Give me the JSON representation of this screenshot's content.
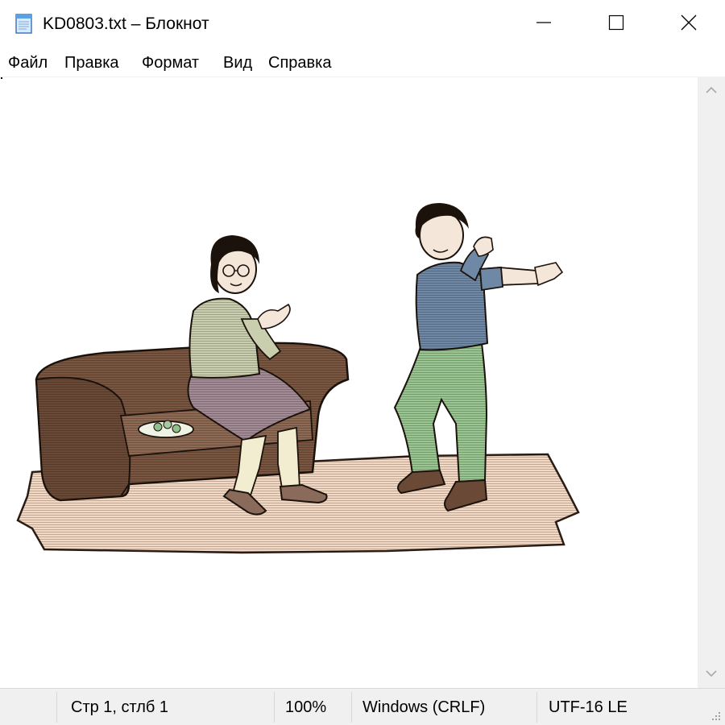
{
  "window": {
    "title": "KD0803.txt – Блокнот",
    "icon": "notepad-icon",
    "controls": [
      "minimize-icon",
      "maximize-icon",
      "close-icon"
    ]
  },
  "menu": {
    "items": [
      {
        "label": "Файл"
      },
      {
        "label": "Правка"
      },
      {
        "label": "Формат"
      },
      {
        "label": "Вид"
      },
      {
        "label": "Справка"
      }
    ]
  },
  "editor": {
    "content": "clipart-image"
  },
  "status": {
    "position": "Стр 1, стлб 1",
    "zoom": "100%",
    "line_endings": "Windows (CRLF)",
    "encoding": "UTF-16 LE"
  },
  "colors": {
    "background": "#ffffff",
    "statusbar": "#f0f0f0",
    "sofa": "#7a5640",
    "rug": "#f3d9c4",
    "sweater": "#c9cfae",
    "skirt": "#a38b95",
    "shirt": "#6e88a6",
    "pants": "#98c590"
  }
}
